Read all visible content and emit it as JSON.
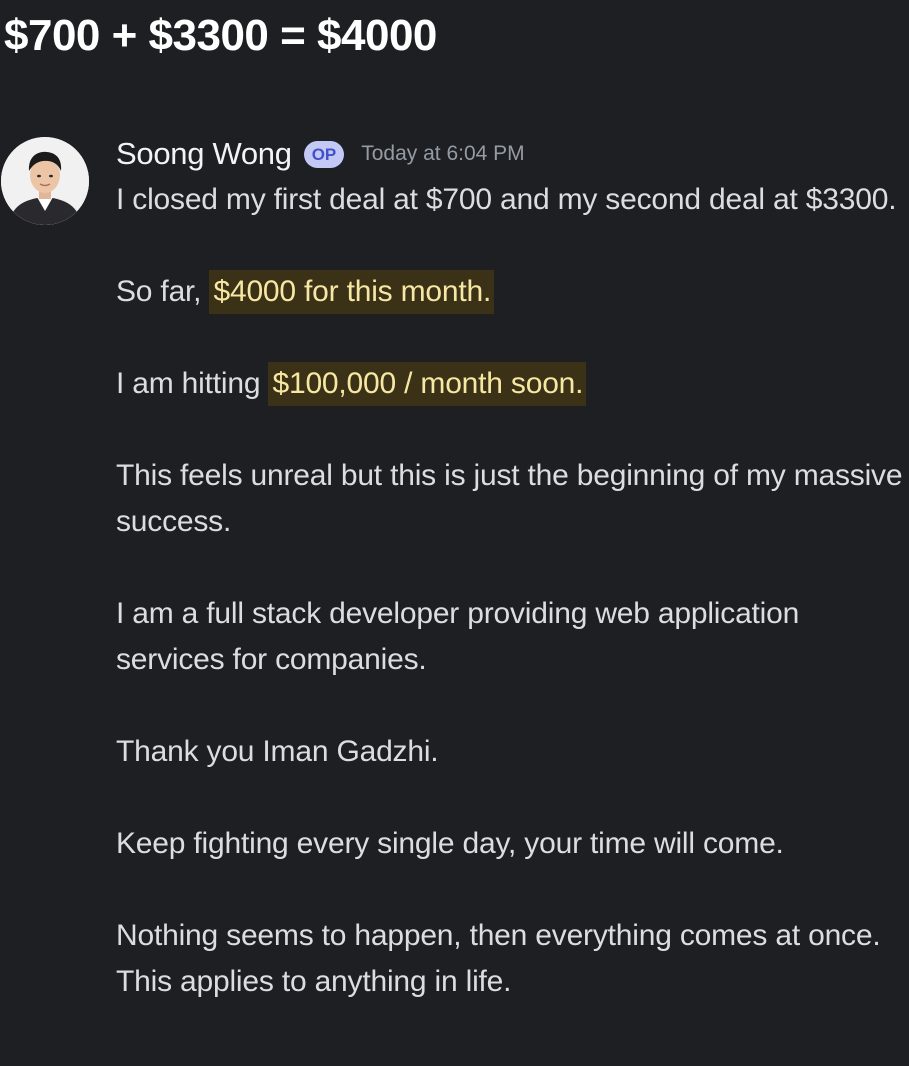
{
  "post_title": "$700 + $3300 = $4000",
  "message": {
    "author": "Soong Wong",
    "badge": "OP",
    "timestamp": "Today at 6:04 PM",
    "paragraphs": {
      "p1": "I closed my first deal at $700 and my second deal at $3300.",
      "p2_prefix": "So far, ",
      "p2_highlight": "$4000 for this month.",
      "p3_prefix": "I am hitting ",
      "p3_highlight": "$100,000 / month soon.",
      "p4": "This feels unreal but this is just the beginning of my massive success.",
      "p5": "I am a full stack developer providing web application services for companies.",
      "p6": "Thank you Iman Gadzhi.",
      "p7": "Keep fighting every single day, your time will come.",
      "p8": "Nothing seems to happen, then everything comes at once. This applies to anything in life."
    }
  },
  "colors": {
    "background": "#1e1f22",
    "text": "#dbdee1",
    "timestamp": "#949ba4",
    "highlight_bg": "#3a3117",
    "highlight_text": "#f6e7a3",
    "badge_bg": "#c4c8f5"
  }
}
